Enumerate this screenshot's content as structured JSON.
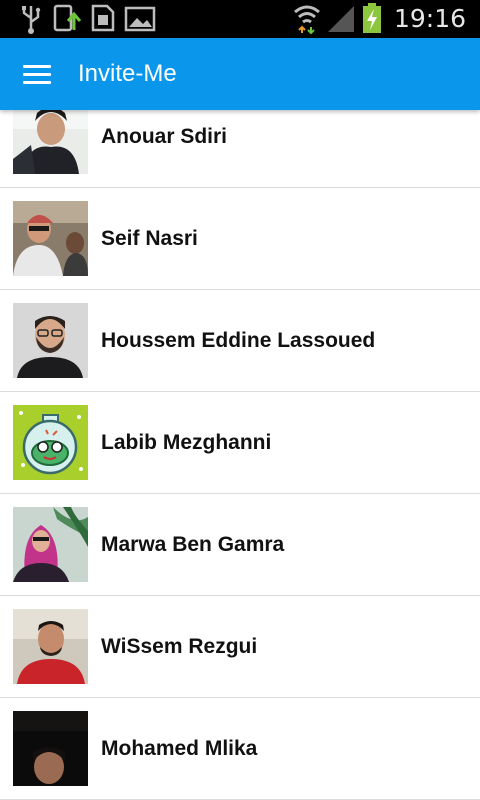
{
  "status_bar": {
    "time": "19:16",
    "icons": [
      "usb-icon",
      "upload-icon",
      "sim-icon",
      "gallery-icon",
      "wifi-icon",
      "signal-icon",
      "battery-charging-icon"
    ]
  },
  "app_bar": {
    "title": "Invite-Me",
    "menu_icon": "hamburger-menu-icon"
  },
  "contacts": [
    {
      "name": "Anouar Sdiri"
    },
    {
      "name": "Seif Nasri"
    },
    {
      "name": "Houssem Eddine Lassoued"
    },
    {
      "name": "Labib Mezghanni"
    },
    {
      "name": "Marwa Ben Gamra"
    },
    {
      "name": "WiSsem Rezgui"
    },
    {
      "name": "Mohamed Mlika"
    }
  ]
}
